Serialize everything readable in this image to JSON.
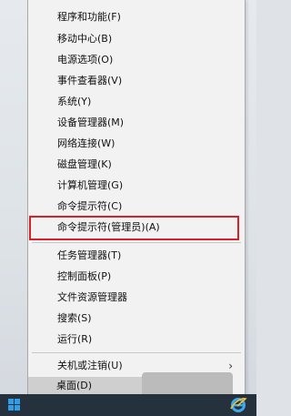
{
  "menu": {
    "items": [
      {
        "label": "程序和功能(F)"
      },
      {
        "label": "移动中心(B)"
      },
      {
        "label": "电源选项(O)"
      },
      {
        "label": "事件查看器(V)"
      },
      {
        "label": "系统(Y)"
      },
      {
        "label": "设备管理器(M)"
      },
      {
        "label": "网络连接(W)"
      },
      {
        "label": "磁盘管理(K)"
      },
      {
        "label": "计算机管理(G)"
      },
      {
        "label": "命令提示符(C)"
      },
      {
        "label": "命令提示符(管理员)(A)"
      },
      {
        "label": "任务管理器(T)"
      },
      {
        "label": "控制面板(P)"
      },
      {
        "label": "文件资源管理器"
      },
      {
        "label": "搜索(S)"
      },
      {
        "label": "运行(R)"
      },
      {
        "label": "关机或注销(U)"
      },
      {
        "label": "桌面(D)"
      }
    ],
    "submenu_arrow": "›"
  },
  "icons": {
    "start": "windows-logo-icon",
    "browser": "internet-explorer-icon"
  },
  "colors": {
    "highlight_border": "#d81f2a",
    "taskbar": "#25313d",
    "windows_blue": "#2f9ee8"
  }
}
